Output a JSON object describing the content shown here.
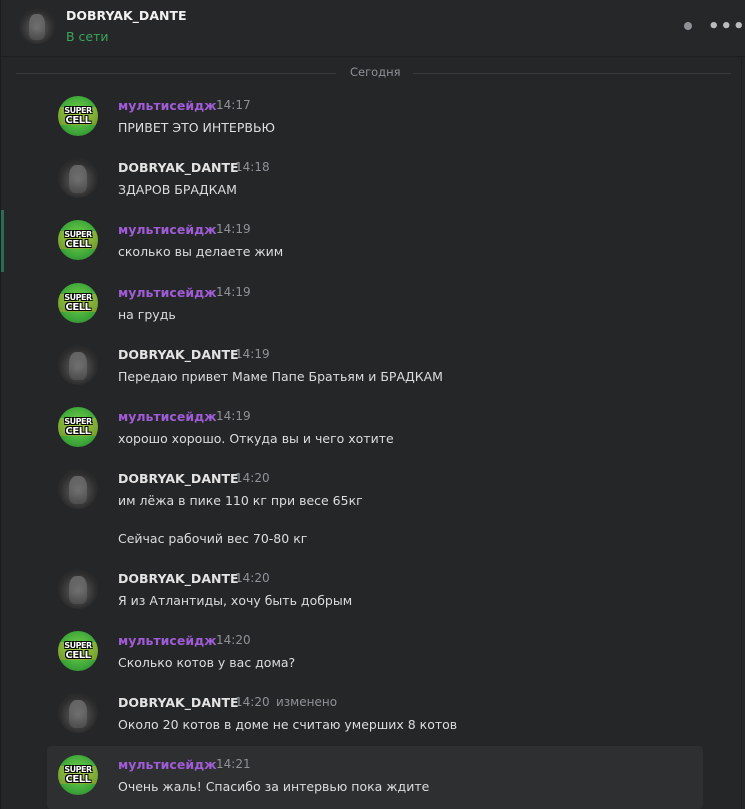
{
  "header": {
    "name": "DOBRYAK_DANTE",
    "status": "В сети",
    "more": "•••"
  },
  "divider": {
    "label": "Сегодня"
  },
  "supercell": {
    "line1": "SUPER",
    "line2": "CELL"
  },
  "messages": [
    {
      "author": "мультисейдж",
      "time": "14:17",
      "text": "ПРИВЕТ ЭТО ИНТЕРВЬЮ"
    },
    {
      "author": "DOBRYAK_DANTE",
      "time": "14:18",
      "text": "ЗДАРОВ БРАДКАМ"
    },
    {
      "author": "мультисейдж",
      "time": "14:19",
      "text": "сколько вы делаете жим"
    },
    {
      "author": "мультисейдж",
      "time": "14:19",
      "text": "на грудь"
    },
    {
      "author": "DOBRYAK_DANTE",
      "time": "14:19",
      "text": "Передаю привет Маме Папе Братьям и БРАДКАМ"
    },
    {
      "author": "мультисейдж",
      "time": "14:19",
      "text": "хорошо хорошо. Откуда вы и чего хотите"
    },
    {
      "author": "DOBRYAK_DANTE",
      "time": "14:20",
      "text": "им лёжа в пике 110 кг при весе 65кг",
      "text2": "Сейчас рабочий вес 70-80 кг"
    },
    {
      "author": "DOBRYAK_DANTE",
      "time": "14:20",
      "text": "Я из Атлантиды, хочу быть добрым"
    },
    {
      "author": "мультисейдж",
      "time": "14:20",
      "text": "Сколько котов у вас дома?"
    },
    {
      "author": "DOBRYAK_DANTE",
      "time": "14:20",
      "edited": "изменено",
      "text": "Около 20 котов в доме не считаю умерших 8 котов"
    },
    {
      "author": "мультисейдж",
      "time": "14:21",
      "text": "Очень жаль! Спасибо за интервью пока ждите"
    }
  ]
}
